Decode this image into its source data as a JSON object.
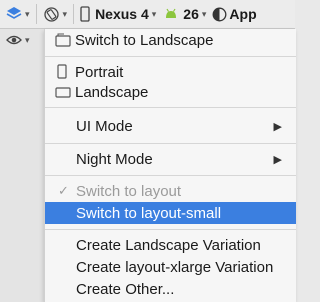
{
  "toolbar": {
    "device_label": "Nexus 4",
    "api_label": "26",
    "app_label": "App",
    "accent": "#3b7fe0"
  },
  "menu": {
    "switch_landscape": "Switch to Landscape",
    "portrait": "Portrait",
    "landscape": "Landscape",
    "ui_mode": "UI Mode",
    "night_mode": "Night Mode",
    "switch_layout": "Switch to layout",
    "switch_layout_small": "Switch to layout-small",
    "create_landscape": "Create Landscape Variation",
    "create_xlarge": "Create layout-xlarge Variation",
    "create_other": "Create Other..."
  },
  "icons": {
    "layers": "layers-icon",
    "rotate": "rotate-icon",
    "device": "phone-icon",
    "android": "android-icon",
    "theme": "theme-icon",
    "eye": "eye-icon"
  }
}
